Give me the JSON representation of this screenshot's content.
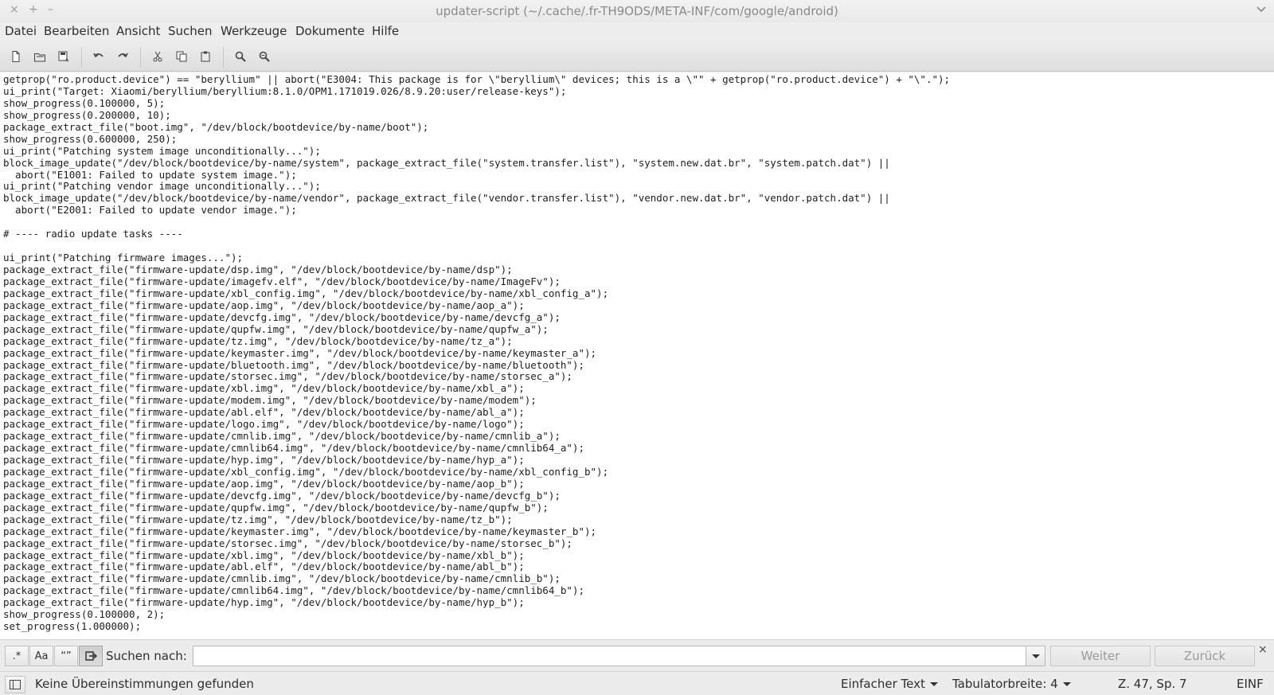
{
  "window": {
    "title": "updater-script (~/.cache/.fr-TH9ODS/META-INF/com/google/android)",
    "controls": {
      "close": "×",
      "maximize": "+",
      "minimize": "–"
    }
  },
  "menu": [
    "Datei",
    "Bearbeiten",
    "Ansicht",
    "Suchen",
    "Werkzeuge",
    "Dokumente",
    "Hilfe"
  ],
  "toolbar": {
    "buttons": [
      "new-document-icon",
      "open-document-icon",
      "save-as-icon",
      "undo-icon",
      "redo-icon",
      "cut-icon",
      "copy-icon",
      "paste-icon",
      "find-icon",
      "find-replace-icon"
    ]
  },
  "editor": {
    "lines": [
      "getprop(\"ro.product.device\") == \"beryllium\" || abort(\"E3004: This package is for \\\"beryllium\\\" devices; this is a \\\"\" + getprop(\"ro.product.device\") + \"\\\".\");",
      "ui_print(\"Target: Xiaomi/beryllium/beryllium:8.1.0/OPM1.171019.026/8.9.20:user/release-keys\");",
      "show_progress(0.100000, 5);",
      "show_progress(0.200000, 10);",
      "package_extract_file(\"boot.img\", \"/dev/block/bootdevice/by-name/boot\");",
      "show_progress(0.600000, 250);",
      "ui_print(\"Patching system image unconditionally...\");",
      "block_image_update(\"/dev/block/bootdevice/by-name/system\", package_extract_file(\"system.transfer.list\"), \"system.new.dat.br\", \"system.patch.dat\") ||",
      "  abort(\"E1001: Failed to update system image.\");",
      "ui_print(\"Patching vendor image unconditionally...\");",
      "block_image_update(\"/dev/block/bootdevice/by-name/vendor\", package_extract_file(\"vendor.transfer.list\"), \"vendor.new.dat.br\", \"vendor.patch.dat\") ||",
      "  abort(\"E2001: Failed to update vendor image.\");",
      "",
      "# ---- radio update tasks ----",
      "",
      "ui_print(\"Patching firmware images...\");",
      "package_extract_file(\"firmware-update/dsp.img\", \"/dev/block/bootdevice/by-name/dsp\");",
      "package_extract_file(\"firmware-update/imagefv.elf\", \"/dev/block/bootdevice/by-name/ImageFv\");",
      "package_extract_file(\"firmware-update/xbl_config.img\", \"/dev/block/bootdevice/by-name/xbl_config_a\");",
      "package_extract_file(\"firmware-update/aop.img\", \"/dev/block/bootdevice/by-name/aop_a\");",
      "package_extract_file(\"firmware-update/devcfg.img\", \"/dev/block/bootdevice/by-name/devcfg_a\");",
      "package_extract_file(\"firmware-update/qupfw.img\", \"/dev/block/bootdevice/by-name/qupfw_a\");",
      "package_extract_file(\"firmware-update/tz.img\", \"/dev/block/bootdevice/by-name/tz_a\");",
      "package_extract_file(\"firmware-update/keymaster.img\", \"/dev/block/bootdevice/by-name/keymaster_a\");",
      "package_extract_file(\"firmware-update/bluetooth.img\", \"/dev/block/bootdevice/by-name/bluetooth\");",
      "package_extract_file(\"firmware-update/storsec.img\", \"/dev/block/bootdevice/by-name/storsec_a\");",
      "package_extract_file(\"firmware-update/xbl.img\", \"/dev/block/bootdevice/by-name/xbl_a\");",
      "package_extract_file(\"firmware-update/modem.img\", \"/dev/block/bootdevice/by-name/modem\");",
      "package_extract_file(\"firmware-update/abl.elf\", \"/dev/block/bootdevice/by-name/abl_a\");",
      "package_extract_file(\"firmware-update/logo.img\", \"/dev/block/bootdevice/by-name/logo\");",
      "package_extract_file(\"firmware-update/cmnlib.img\", \"/dev/block/bootdevice/by-name/cmnlib_a\");",
      "package_extract_file(\"firmware-update/cmnlib64.img\", \"/dev/block/bootdevice/by-name/cmnlib64_a\");",
      "package_extract_file(\"firmware-update/hyp.img\", \"/dev/block/bootdevice/by-name/hyp_a\");",
      "package_extract_file(\"firmware-update/xbl_config.img\", \"/dev/block/bootdevice/by-name/xbl_config_b\");",
      "package_extract_file(\"firmware-update/aop.img\", \"/dev/block/bootdevice/by-name/aop_b\");",
      "package_extract_file(\"firmware-update/devcfg.img\", \"/dev/block/bootdevice/by-name/devcfg_b\");",
      "package_extract_file(\"firmware-update/qupfw.img\", \"/dev/block/bootdevice/by-name/qupfw_b\");",
      "package_extract_file(\"firmware-update/tz.img\", \"/dev/block/bootdevice/by-name/tz_b\");",
      "package_extract_file(\"firmware-update/keymaster.img\", \"/dev/block/bootdevice/by-name/keymaster_b\");",
      "package_extract_file(\"firmware-update/storsec.img\", \"/dev/block/bootdevice/by-name/storsec_b\");",
      "package_extract_file(\"firmware-update/xbl.img\", \"/dev/block/bootdevice/by-name/xbl_b\");",
      "package_extract_file(\"firmware-update/abl.elf\", \"/dev/block/bootdevice/by-name/abl_b\");",
      "package_extract_file(\"firmware-update/cmnlib.img\", \"/dev/block/bootdevice/by-name/cmnlib_b\");",
      "package_extract_file(\"firmware-update/cmnlib64.img\", \"/dev/block/bootdevice/by-name/cmnlib64_b\");",
      "package_extract_file(\"firmware-update/hyp.img\", \"/dev/block/bootdevice/by-name/hyp_b\");",
      "show_progress(0.100000, 2);",
      "set_progress(1.000000);"
    ]
  },
  "search": {
    "regex_label": ".*",
    "case_label": "Aa",
    "quote_label": "“”",
    "label": "Suchen nach:",
    "value": "",
    "next_label": "Weiter",
    "prev_label": "Zurück",
    "close": "×"
  },
  "status": {
    "message": "Keine Übereinstimmungen gefunden",
    "syntax": "Einfacher Text",
    "tab_width": "Tabulatorbreite: 4",
    "position": "Z. 47, Sp. 7",
    "mode": "EINF"
  }
}
